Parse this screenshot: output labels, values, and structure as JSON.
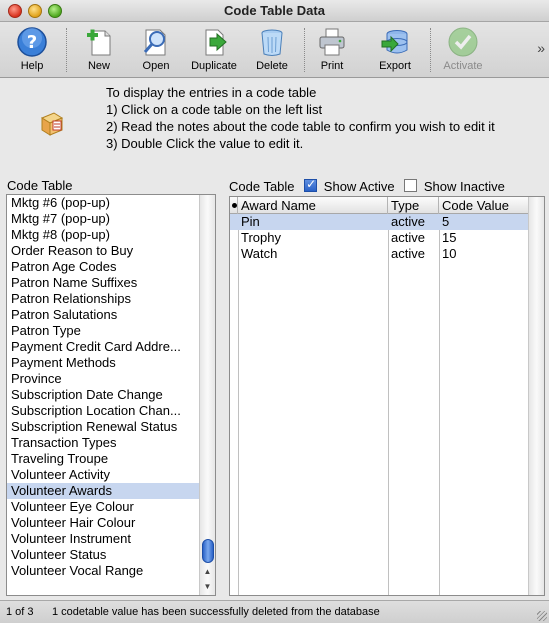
{
  "window": {
    "title": "Code Table Data"
  },
  "toolbar": {
    "items": [
      {
        "label": "Help",
        "icon": "help-icon",
        "enabled": true
      },
      {
        "label": "New",
        "icon": "new-document-icon",
        "enabled": true
      },
      {
        "label": "Open",
        "icon": "magnifier-icon",
        "enabled": true
      },
      {
        "label": "Duplicate",
        "icon": "duplicate-icon",
        "enabled": true
      },
      {
        "label": "Delete",
        "icon": "trash-icon",
        "enabled": true
      },
      {
        "label": "Print",
        "icon": "printer-icon",
        "enabled": true
      },
      {
        "label": "Export",
        "icon": "export-icon",
        "enabled": true
      },
      {
        "label": "Activate",
        "icon": "checkmark-icon",
        "enabled": false
      }
    ]
  },
  "instructions": {
    "lines": [
      "To display the entries in a code table",
      "1) Click on a code table on the left list",
      "2) Read the notes about the code table to confirm you wish to edit it",
      "3) Double Click the value to edit it."
    ]
  },
  "left_pane": {
    "title": "Code Table",
    "items": [
      "Mktg #6 (pop-up)",
      "Mktg #7 (pop-up)",
      "Mktg #8 (pop-up)",
      "Order Reason to Buy",
      "Patron Age Codes",
      "Patron Name Suffixes",
      "Patron Relationships",
      "Patron Salutations",
      "Patron Type",
      "Payment Credit Card Addre...",
      "Payment Methods",
      "Province",
      "Subscription Date Change",
      "Subscription Location Chan...",
      "Subscription Renewal Status",
      "Transaction Types",
      "Traveling Troupe",
      "Volunteer Activity",
      "Volunteer Awards",
      "Volunteer Eye Colour",
      "Volunteer Hair Colour",
      "Volunteer Instrument",
      "Volunteer Status",
      "Volunteer Vocal Range"
    ],
    "selected": "Volunteer Awards"
  },
  "right_pane": {
    "label": "Code Table",
    "show_active_label": "Show Active",
    "show_active_checked": true,
    "show_inactive_label": "Show Inactive",
    "show_inactive_checked": false,
    "columns": [
      "Award Name",
      "Type",
      "Code Value"
    ],
    "rows": [
      {
        "name": "Pin",
        "type": "active",
        "value": "5"
      },
      {
        "name": "Trophy",
        "type": "active",
        "value": "15"
      },
      {
        "name": "Watch",
        "type": "active",
        "value": "10"
      }
    ],
    "selected_row": 0
  },
  "status": {
    "page": "1 of 3",
    "message": "1 codetable value has been successfully deleted from the database"
  },
  "colors": {
    "selection": "#c7d6ef",
    "accent": "#2a62c7"
  }
}
